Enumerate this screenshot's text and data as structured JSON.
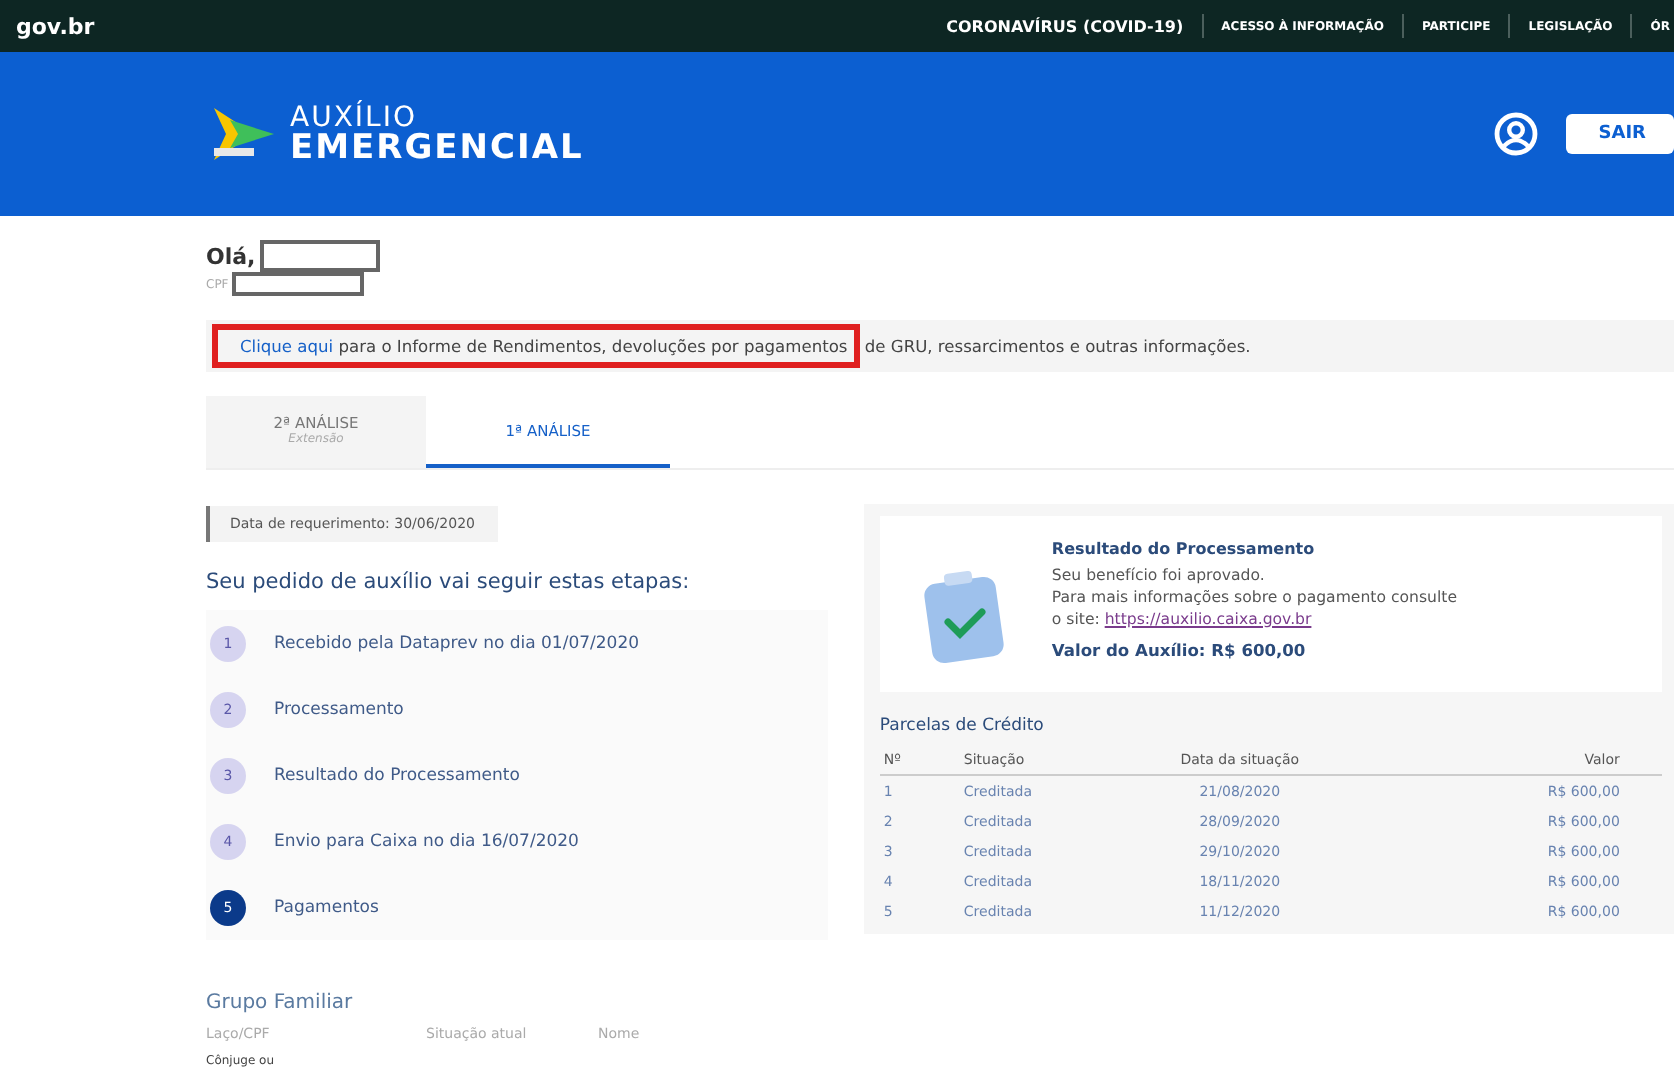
{
  "top_bar": {
    "logo": "gov.br",
    "links": [
      "CORONAVÍRUS (COVID-19)",
      "ACESSO À INFORMAÇÃO",
      "PARTICIPE",
      "LEGISLAÇÃO",
      "ÓR"
    ]
  },
  "header": {
    "title_line1": "AUXÍLIO",
    "title_line2": "EMERGENCIAL",
    "logout": "SAIR"
  },
  "greeting": {
    "hello": "Olá,",
    "cpf_label": "CPF"
  },
  "notice": {
    "link": "Clique aqui",
    "text_framed": " para o Informe de Rendimentos, devoluções por pagamentos",
    "text": " de GRU, ressarcimentos e outras informações.",
    "highlighted": true
  },
  "tabs": [
    {
      "label": "2ª ANÁLISE",
      "sub": "Extensão",
      "selected": false
    },
    {
      "label": "1ª ANÁLISE",
      "selected": true
    }
  ],
  "request_date": "Data de requerimento: 30/06/2020",
  "steps_title": "Seu pedido de auxílio vai seguir estas etapas:",
  "steps": [
    {
      "number": "1",
      "label": "Recebido pela Dataprev no dia 01/07/2020",
      "active": false
    },
    {
      "number": "2",
      "label": "Processamento",
      "active": false
    },
    {
      "number": "3",
      "label": "Resultado do Processamento",
      "active": false
    },
    {
      "number": "4",
      "label": "Envio para Caixa no dia 16/07/2020",
      "active": false
    },
    {
      "number": "5",
      "label": "Pagamentos",
      "active": true
    }
  ],
  "result": {
    "title": "Resultado do Processamento",
    "line1": "Seu benefício foi aprovado.",
    "line2": "Para mais informações sobre o pagamento consulte",
    "site_prefix": "o site: ",
    "site_link": "https://auxilio.caixa.gov.br",
    "value": "Valor do Auxílio: R$ 600,00"
  },
  "installments": {
    "title": "Parcelas de Crédito",
    "columns": [
      "Nº",
      "Situação",
      "Data da situação",
      "Valor"
    ],
    "rows": [
      [
        "1",
        "Creditada",
        "21/08/2020",
        "R$ 600,00"
      ],
      [
        "2",
        "Creditada",
        "28/09/2020",
        "R$ 600,00"
      ],
      [
        "3",
        "Creditada",
        "29/10/2020",
        "R$ 600,00"
      ],
      [
        "4",
        "Creditada",
        "18/11/2020",
        "R$ 600,00"
      ],
      [
        "5",
        "Creditada",
        "11/12/2020",
        "R$ 600,00"
      ]
    ]
  },
  "family": {
    "title": "Grupo Familiar",
    "columns": [
      "Laço/CPF",
      "Situação atual",
      "Nome"
    ],
    "rows": [
      [
        "Cônjuge ou"
      ]
    ]
  }
}
